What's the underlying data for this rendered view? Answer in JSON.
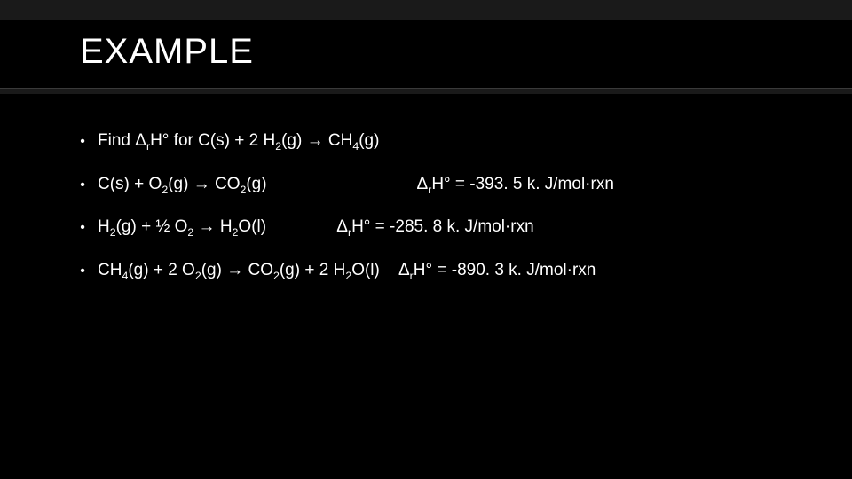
{
  "title": "EXAMPLE",
  "bullets": [
    {
      "prefix": "Find Δ",
      "sub1": "r",
      "mid1": "H° for C(s) + 2 H",
      "sub2": "2",
      "mid2": "(g) → CH",
      "sub3": "4",
      "tail": "(g)"
    },
    {
      "prefix": "C(s) + O",
      "sub1": "2",
      "mid1": "(g) → CO",
      "sub2": "2",
      "mid2": "(g)                                Δ",
      "sub3": "r",
      "tail": "H° = -393. 5 k. J/mol·rxn"
    },
    {
      "prefix": "H",
      "sub1": "2",
      "mid1": "(g) + ½ O",
      "sub2": "2",
      "mid2": " → H",
      "sub3": "2",
      "mid3": "O(l)               Δ",
      "sub4": "r",
      "tail": "H° = -285. 8 k. J/mol·rxn"
    },
    {
      "prefix": "CH",
      "sub1": "4",
      "mid1": "(g) + 2 O",
      "sub2": "2",
      "mid2": "(g) → CO",
      "sub3": "2",
      "mid3": "(g) + 2 H",
      "sub4": "2",
      "mid4": "O(l)    Δ",
      "sub5": "r",
      "tail": "H° = -890. 3 k. J/mol·rxn"
    }
  ]
}
